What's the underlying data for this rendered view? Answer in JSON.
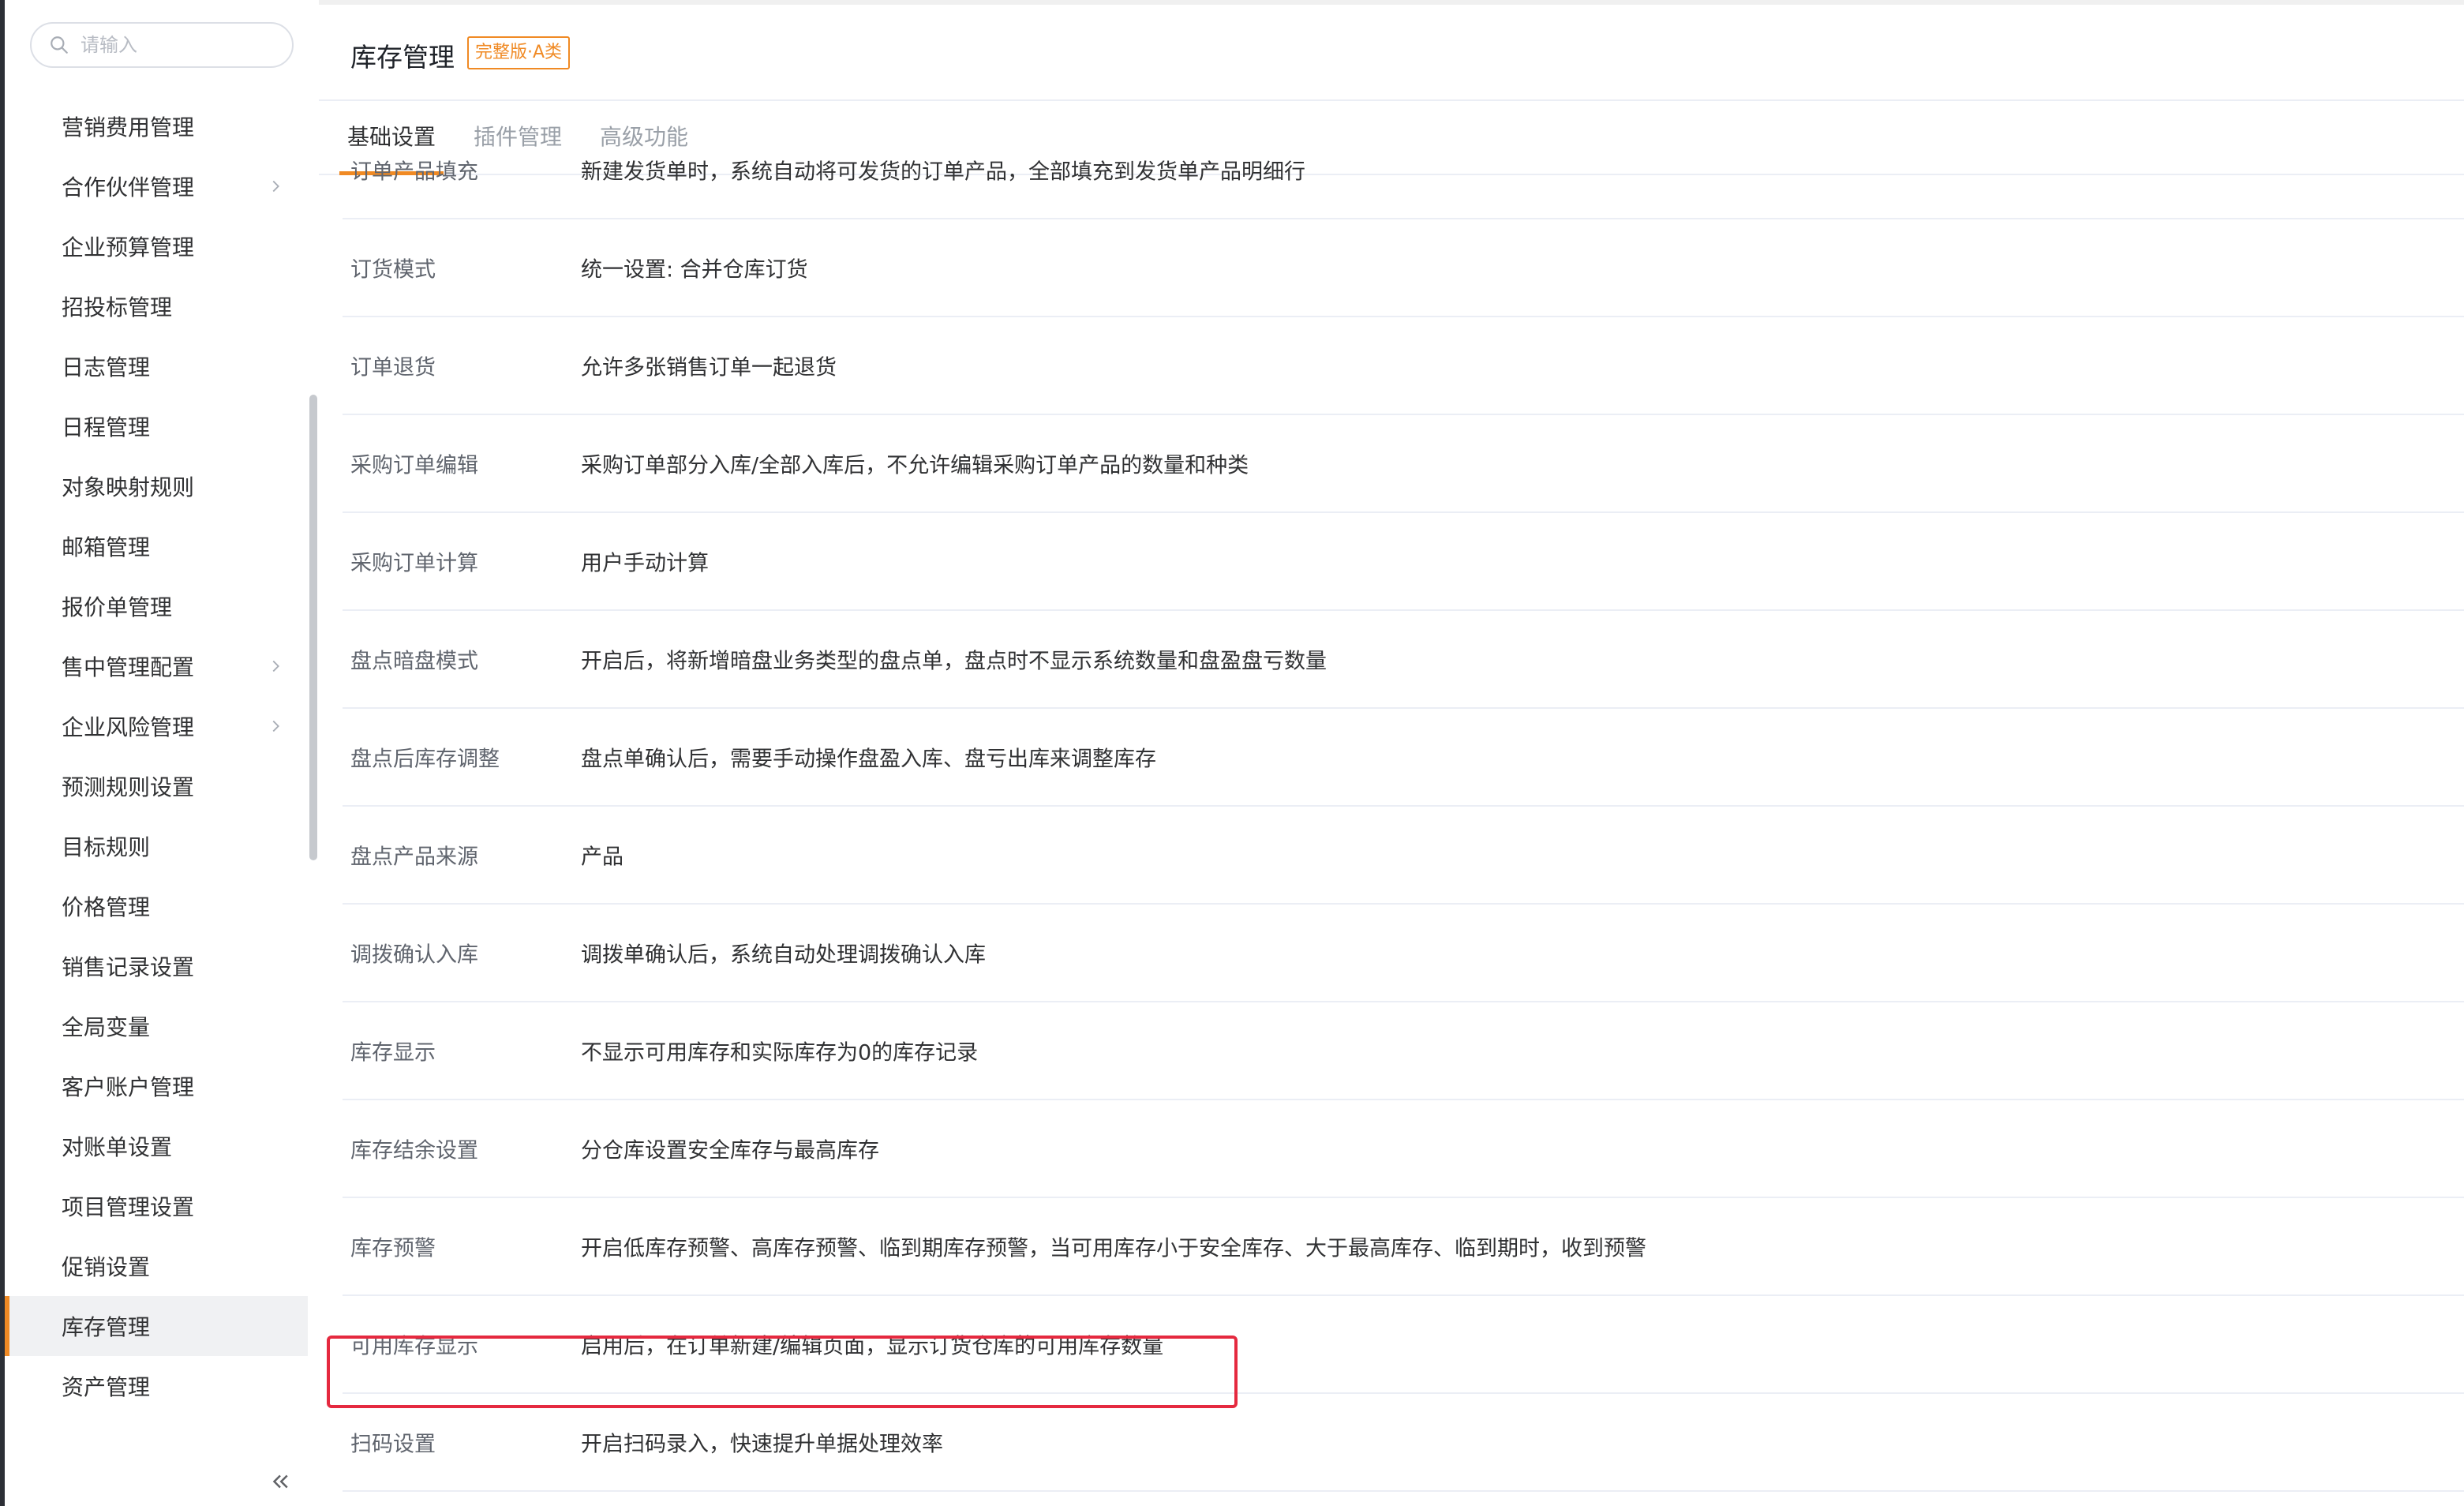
{
  "search": {
    "placeholder": "请输入"
  },
  "sidebar": {
    "items": [
      {
        "label": "营销费用管理",
        "has_children": false,
        "active": false
      },
      {
        "label": "合作伙伴管理",
        "has_children": true,
        "active": false
      },
      {
        "label": "企业预算管理",
        "has_children": false,
        "active": false
      },
      {
        "label": "招投标管理",
        "has_children": false,
        "active": false
      },
      {
        "label": "日志管理",
        "has_children": false,
        "active": false
      },
      {
        "label": "日程管理",
        "has_children": false,
        "active": false
      },
      {
        "label": "对象映射规则",
        "has_children": false,
        "active": false
      },
      {
        "label": "邮箱管理",
        "has_children": false,
        "active": false
      },
      {
        "label": "报价单管理",
        "has_children": false,
        "active": false
      },
      {
        "label": "售中管理配置",
        "has_children": true,
        "active": false
      },
      {
        "label": "企业风险管理",
        "has_children": true,
        "active": false
      },
      {
        "label": "预测规则设置",
        "has_children": false,
        "active": false
      },
      {
        "label": "目标规则",
        "has_children": false,
        "active": false
      },
      {
        "label": "价格管理",
        "has_children": false,
        "active": false
      },
      {
        "label": "销售记录设置",
        "has_children": false,
        "active": false
      },
      {
        "label": "全局变量",
        "has_children": false,
        "active": false
      },
      {
        "label": "客户账户管理",
        "has_children": false,
        "active": false
      },
      {
        "label": "对账单设置",
        "has_children": false,
        "active": false
      },
      {
        "label": "项目管理设置",
        "has_children": false,
        "active": false
      },
      {
        "label": "促销设置",
        "has_children": false,
        "active": false
      },
      {
        "label": "库存管理",
        "has_children": false,
        "active": true
      },
      {
        "label": "资产管理",
        "has_children": false,
        "active": false
      }
    ]
  },
  "header": {
    "title": "库存管理",
    "edition_badge": "完整版·A类"
  },
  "tabs": [
    {
      "label": "基础设置",
      "active": true
    },
    {
      "label": "插件管理",
      "active": false
    },
    {
      "label": "高级功能",
      "active": false
    }
  ],
  "settings": [
    {
      "label": "订单产品填充",
      "value": "新建发货单时，系统自动将可发货的订单产品，全部填充到发货单产品明细行"
    },
    {
      "label": "订货模式",
      "value": "统一设置: 合并仓库订货"
    },
    {
      "label": "订单退货",
      "value": "允许多张销售订单一起退货"
    },
    {
      "label": "采购订单编辑",
      "value": "采购订单部分入库/全部入库后，不允许编辑采购订单产品的数量和种类"
    },
    {
      "label": "采购订单计算",
      "value": "用户手动计算"
    },
    {
      "label": "盘点暗盘模式",
      "value": "开启后，将新增暗盘业务类型的盘点单，盘点时不显示系统数量和盘盈盘亏数量"
    },
    {
      "label": "盘点后库存调整",
      "value": "盘点单确认后，需要手动操作盘盈入库、盘亏出库来调整库存"
    },
    {
      "label": "盘点产品来源",
      "value": "产品"
    },
    {
      "label": "调拨确认入库",
      "value": "调拨单确认后，系统自动处理调拨确认入库"
    },
    {
      "label": "库存显示",
      "value": "不显示可用库存和实际库存为0的库存记录"
    },
    {
      "label": "库存结余设置",
      "value": "分仓库设置安全库存与最高库存"
    },
    {
      "label": "库存预警",
      "value": "开启低库存预警、高库存预警、临到期库存预警，当可用库存小于安全库存、大于最高库存、临到期时，收到预警"
    },
    {
      "label": "可用库存显示",
      "value": "启用后，在订单新建/编辑页面，显示订货仓库的可用库存数量"
    },
    {
      "label": "扫码设置",
      "value": "开启扫码录入，快速提升单据处理效率"
    }
  ],
  "colors": {
    "accent": "#f08a24",
    "highlight": "#e5293f"
  }
}
